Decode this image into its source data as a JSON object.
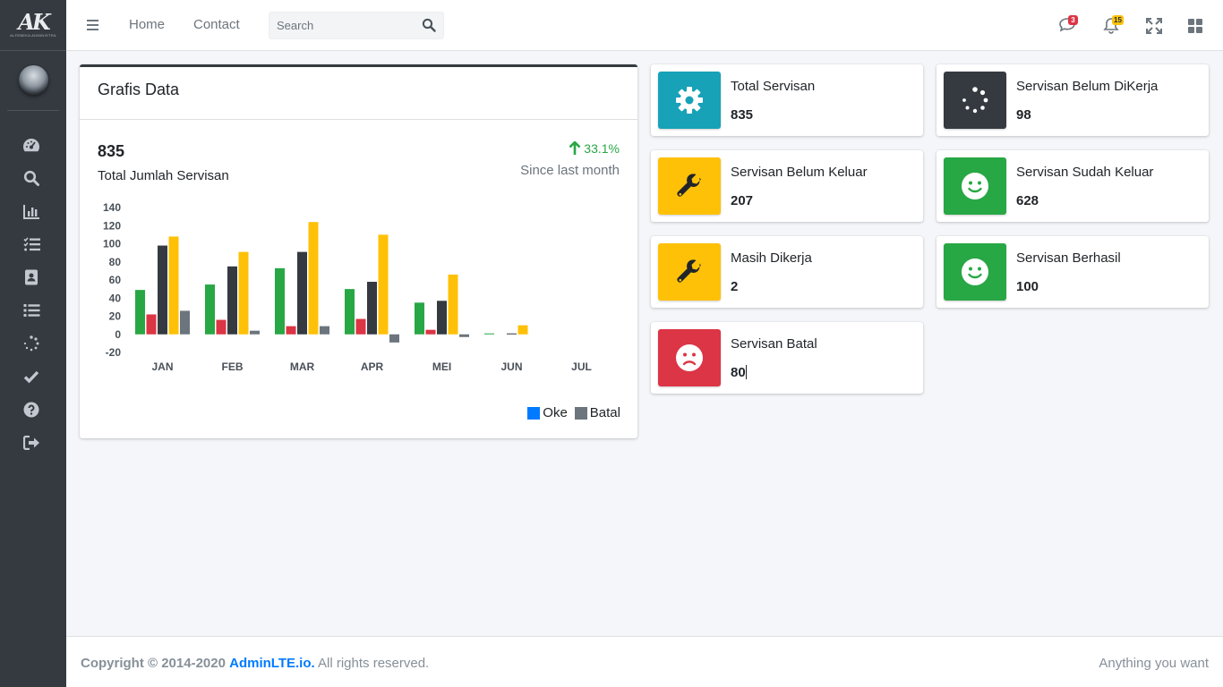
{
  "brand": {
    "logo_text": "AK",
    "subtitle": "ALFEBEKA ADMINISTRA"
  },
  "sidebar": {
    "items": [
      {
        "icon": "tachometer-icon",
        "name": "dashboard"
      },
      {
        "icon": "search-icon",
        "name": "search"
      },
      {
        "icon": "chart-bar-icon",
        "name": "charts"
      },
      {
        "icon": "tasks-icon",
        "name": "tasks"
      },
      {
        "icon": "address-book-icon",
        "name": "records"
      },
      {
        "icon": "list-icon",
        "name": "list"
      },
      {
        "icon": "spinner-icon",
        "name": "pending"
      },
      {
        "icon": "check-icon",
        "name": "done"
      },
      {
        "icon": "question-icon",
        "name": "help"
      },
      {
        "icon": "sign-out-icon",
        "name": "logout"
      }
    ]
  },
  "navbar": {
    "home_label": "Home",
    "contact_label": "Contact",
    "search_placeholder": "Search",
    "messages_count": "3",
    "notifications_count": "15",
    "badge_colors": {
      "messages": "#dc3545",
      "notifications": "#ffc107"
    }
  },
  "card": {
    "title": "Grafis Data",
    "total": "835",
    "total_label": "Total Jumlah Servisan",
    "change_pct": "33.1%",
    "change_label": "Since last month"
  },
  "chart_data": {
    "type": "bar",
    "categories": [
      "JAN",
      "FEB",
      "MAR",
      "APR",
      "MEI",
      "JUN",
      "JUL"
    ],
    "ylim": [
      -20,
      140
    ],
    "yticks": [
      140,
      120,
      100,
      80,
      60,
      40,
      20,
      0,
      -20
    ],
    "series": [
      {
        "color": "#28a745",
        "values": [
          49,
          55,
          73,
          50,
          35,
          1,
          0
        ]
      },
      {
        "color": "#dc3545",
        "values": [
          22,
          16,
          9,
          17,
          5,
          0,
          0
        ]
      },
      {
        "color": "#343a40",
        "values": [
          98,
          75,
          91,
          58,
          37,
          1,
          0
        ]
      },
      {
        "color": "#ffc107",
        "values": [
          108,
          91,
          124,
          110,
          66,
          10,
          0
        ]
      },
      {
        "color": "#6c757d",
        "values": [
          26,
          4,
          9,
          -9,
          -3,
          0,
          0
        ]
      }
    ],
    "legend": [
      {
        "name": "Oke",
        "color": "#007bff"
      },
      {
        "name": "Batal",
        "color": "#6c757d"
      }
    ],
    "legend_position": "bottom-right"
  },
  "info_boxes": [
    {
      "label": "Total Servisan",
      "value": "835",
      "icon": "cog-icon",
      "color": "#17a2b8"
    },
    {
      "label": "Servisan Belum DiKerja",
      "value": "98",
      "icon": "spinner-icon",
      "color": "#343a40"
    },
    {
      "label": "Servisan Belum Keluar",
      "value": "207",
      "icon": "wrench-icon",
      "color": "#ffc107"
    },
    {
      "label": "Servisan Sudah Keluar",
      "value": "628",
      "icon": "smile-icon",
      "color": "#28a745"
    },
    {
      "label": "Masih Dikerja",
      "value": "2",
      "icon": "wrench-icon",
      "color": "#ffc107"
    },
    {
      "label": "Servisan Berhasil",
      "value": "100",
      "icon": "smile-icon",
      "color": "#28a745"
    },
    {
      "label": "Servisan Batal",
      "value": "80",
      "icon": "frown-icon",
      "color": "#dc3545"
    }
  ],
  "footer": {
    "copyright_prefix": "Copyright © 2014-2020",
    "link_text": "AdminLTE.io.",
    "rights": "All rights reserved.",
    "right_text": "Anything you want"
  }
}
